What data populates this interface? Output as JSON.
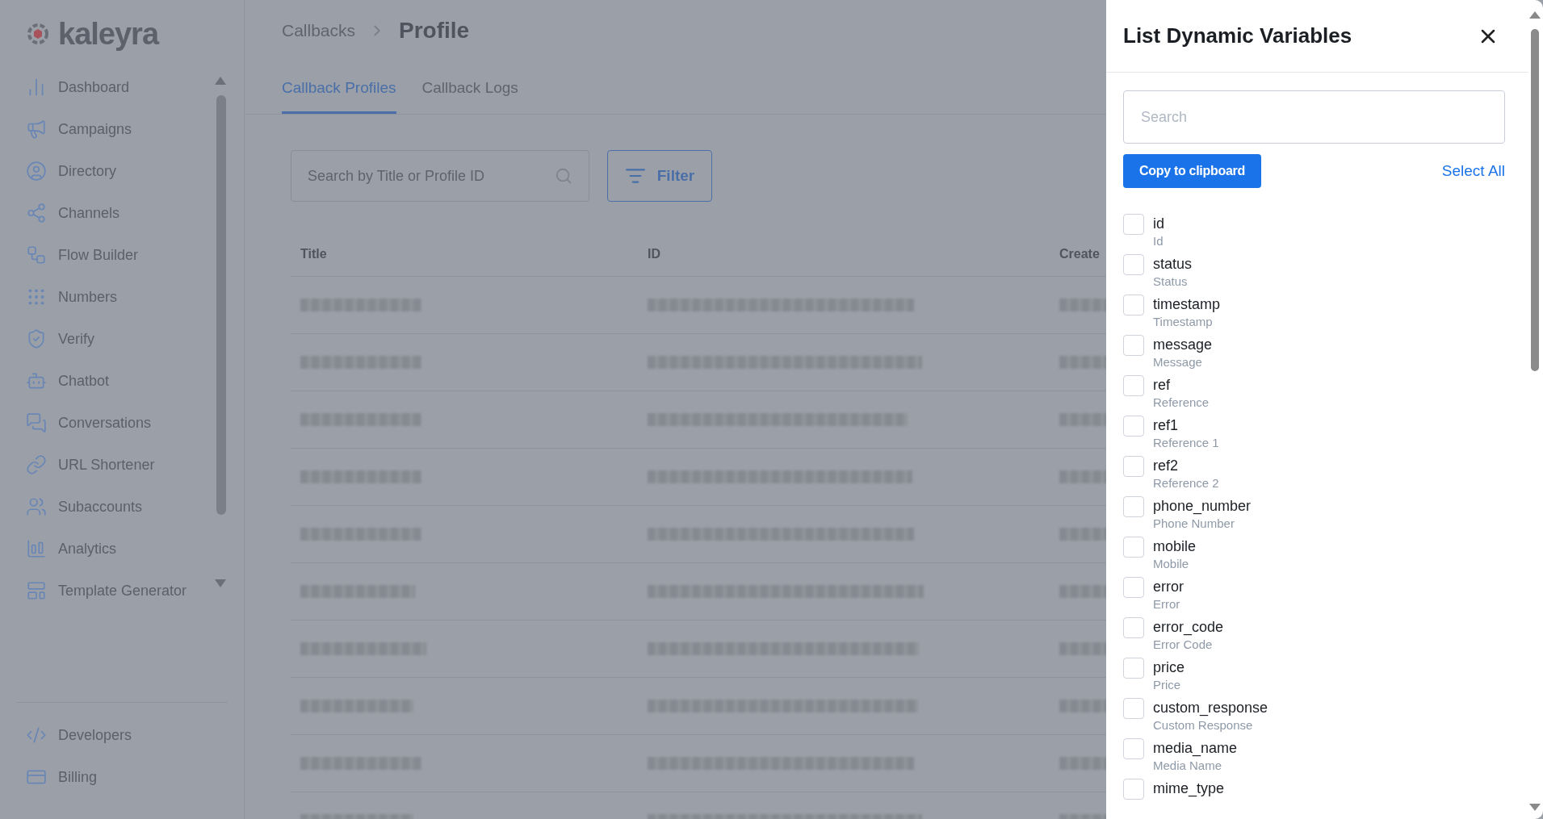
{
  "sidebar": {
    "logo": "kaleyra",
    "items": [
      {
        "label": "Dashboard"
      },
      {
        "label": "Campaigns"
      },
      {
        "label": "Directory"
      },
      {
        "label": "Channels"
      },
      {
        "label": "Flow Builder"
      },
      {
        "label": "Numbers"
      },
      {
        "label": "Verify"
      },
      {
        "label": "Chatbot"
      },
      {
        "label": "Conversations"
      },
      {
        "label": "URL Shortener"
      },
      {
        "label": "Subaccounts"
      },
      {
        "label": "Analytics"
      },
      {
        "label": "Template Generator"
      }
    ],
    "footer_items": [
      {
        "label": "Developers"
      },
      {
        "label": "Billing"
      }
    ]
  },
  "breadcrumb": [
    "Callbacks",
    "Profile"
  ],
  "tabs": [
    {
      "label": "Callback Profiles",
      "selected": true
    },
    {
      "label": "Callback Logs",
      "selected": false
    }
  ],
  "search": {
    "placeholder": "Search by Title or Profile ID"
  },
  "filter_button": "Filter",
  "table": {
    "columns": [
      "Title",
      "ID",
      "Create"
    ]
  },
  "drawer": {
    "title": "List Dynamic Variables",
    "search": {
      "placeholder": "Search"
    },
    "copy_button": "Copy to clipboard",
    "select_all": "Select All",
    "variables": [
      {
        "name": "id",
        "label": "Id",
        "checked": false
      },
      {
        "name": "status",
        "label": "Status",
        "checked": false
      },
      {
        "name": "timestamp",
        "label": "Timestamp",
        "checked": false
      },
      {
        "name": "message",
        "label": "Message",
        "checked": false
      },
      {
        "name": "ref",
        "label": "Reference",
        "checked": false
      },
      {
        "name": "ref1",
        "label": "Reference 1",
        "checked": false
      },
      {
        "name": "ref2",
        "label": "Reference 2",
        "checked": false
      },
      {
        "name": "phone_number",
        "label": "Phone Number",
        "checked": false
      },
      {
        "name": "mobile",
        "label": "Mobile",
        "checked": false
      },
      {
        "name": "error",
        "label": "Error",
        "checked": false
      },
      {
        "name": "error_code",
        "label": "Error Code",
        "checked": false
      },
      {
        "name": "price",
        "label": "Price",
        "checked": false
      },
      {
        "name": "custom_response",
        "label": "Custom Response",
        "checked": false
      },
      {
        "name": "media_name",
        "label": "Media Name",
        "checked": false
      },
      {
        "name": "mime_type",
        "checked": false
      }
    ]
  }
}
